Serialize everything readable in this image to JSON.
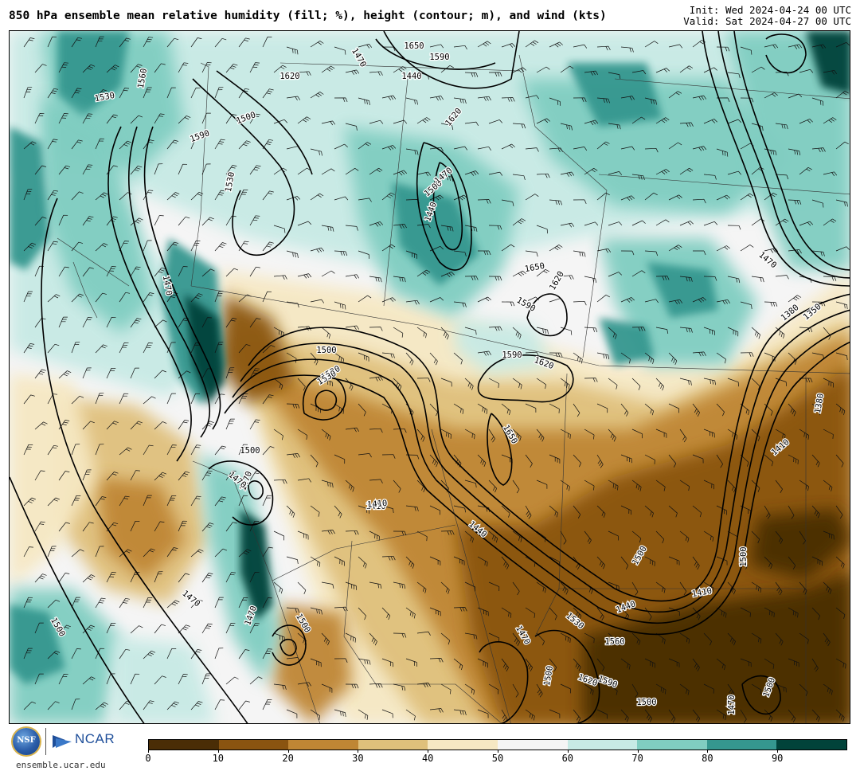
{
  "header": {
    "title": "850 hPa ensemble mean relative humidity (fill; %), height (contour; m), and wind (kts)",
    "init": "Init: Wed 2024-04-24 00 UTC",
    "valid": "Valid: Sat 2024-04-27 00 UTC"
  },
  "footer": {
    "org_logo_text": "NSF",
    "ncar_text": "NCAR",
    "site": "ensemble.ucar.edu"
  },
  "colorbar": {
    "colors": [
      "#4a2d06",
      "#8a5410",
      "#bf8634",
      "#dfc07b",
      "#f6e8c3",
      "#f5f5f5",
      "#c7eae5",
      "#80cdc1",
      "#35978f",
      "#01433a"
    ],
    "ticks": [
      "0",
      "10",
      "20",
      "30",
      "40",
      "50",
      "60",
      "70",
      "80",
      "90"
    ]
  },
  "map": {
    "contour_labels": [
      {
        "text": "1530"
      },
      {
        "text": "1560"
      },
      {
        "text": "1590"
      },
      {
        "text": "1620"
      },
      {
        "text": "1500"
      },
      {
        "text": "1530"
      },
      {
        "text": "1470"
      },
      {
        "text": "1650"
      },
      {
        "text": "1590"
      },
      {
        "text": "1440"
      },
      {
        "text": "1620"
      },
      {
        "text": "1500"
      },
      {
        "text": "1470"
      },
      {
        "text": "1440"
      },
      {
        "text": "1410"
      },
      {
        "text": "1470"
      },
      {
        "text": "1500"
      },
      {
        "text": "1530"
      },
      {
        "text": "1650"
      },
      {
        "text": "1620"
      },
      {
        "text": "1590"
      },
      {
        "text": "1650"
      },
      {
        "text": "1620"
      },
      {
        "text": "1590"
      },
      {
        "text": "1500"
      },
      {
        "text": "1530"
      },
      {
        "text": "1410"
      },
      {
        "text": "1440"
      },
      {
        "text": "1470"
      },
      {
        "text": "1500"
      },
      {
        "text": "1470"
      },
      {
        "text": "1440"
      },
      {
        "text": "1410"
      },
      {
        "text": "1380"
      },
      {
        "text": "1350"
      },
      {
        "text": "1380"
      },
      {
        "text": "1410"
      },
      {
        "text": "1470"
      },
      {
        "text": "1500"
      },
      {
        "text": "1500"
      },
      {
        "text": "1530"
      },
      {
        "text": "1560"
      },
      {
        "text": "1590"
      },
      {
        "text": "1620"
      },
      {
        "text": "1500"
      },
      {
        "text": "1470"
      },
      {
        "text": "1500"
      },
      {
        "text": "1470"
      },
      {
        "text": "1470"
      },
      {
        "text": "1500"
      },
      {
        "text": "1500"
      },
      {
        "text": "1470"
      }
    ]
  }
}
